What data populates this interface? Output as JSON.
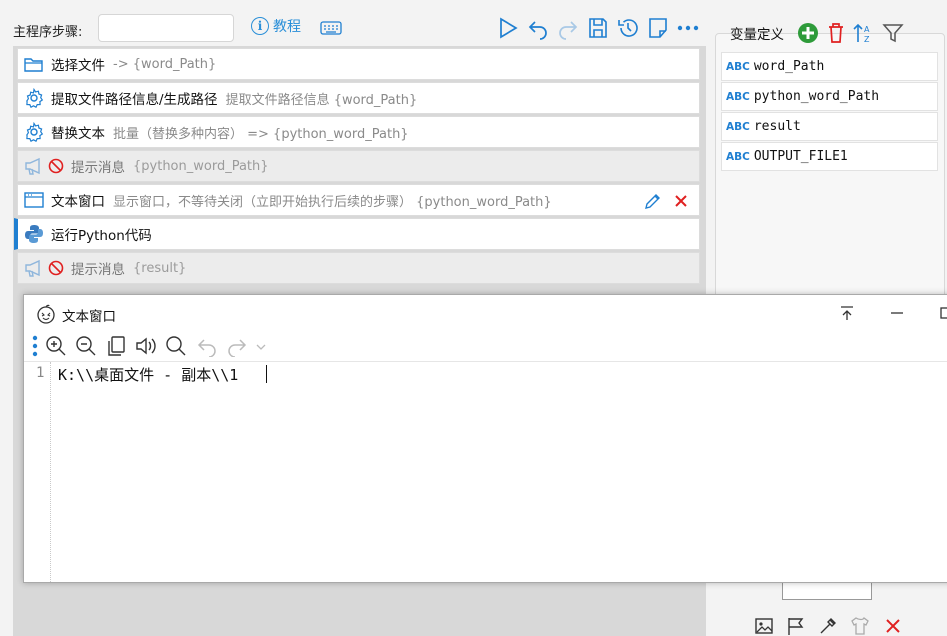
{
  "toolbar": {
    "steps_label": "主程序步骤:",
    "steps_input_value": "",
    "tutorial_label": "教程",
    "icons": [
      "info-icon",
      "keyboard-icon",
      "run-icon",
      "undo-icon",
      "redo-icon",
      "save-icon",
      "history-icon",
      "note-icon",
      "more-icon"
    ]
  },
  "steps": [
    {
      "name": "选择文件",
      "desc": "-> {word_Path}",
      "icon": "folder-icon",
      "disabled": false
    },
    {
      "name": "提取文件路径信息/生成路径",
      "desc": "提取文件路径信息 {word_Path}",
      "icon": "gear-icon",
      "disabled": false
    },
    {
      "name": "替换文本",
      "desc": "批量（替换多种内容） => {python_word_Path}",
      "icon": "gear-icon",
      "disabled": false
    },
    {
      "name": "提示消息",
      "desc": "{python_word_Path}",
      "icon": "megaphone-icon",
      "disabled": true
    },
    {
      "name": "文本窗口",
      "desc": "显示窗口，不等待关闭（立即开始执行后续的步骤） {python_word_Path}",
      "icon": "window-icon",
      "disabled": false
    },
    {
      "name": "运行Python代码",
      "desc": "",
      "icon": "python-icon",
      "disabled": false,
      "active": true
    },
    {
      "name": "提示消息",
      "desc": "{result}",
      "icon": "megaphone-icon",
      "disabled": true
    }
  ],
  "variables": {
    "title": "变量定义",
    "type_badge": "ABC",
    "items": [
      "word_Path",
      "python_word_Path",
      "result",
      "OUTPUT_FILE1"
    ]
  },
  "text_window": {
    "title": "文本窗口",
    "line_number": "1",
    "content": "K:\\\\桌面文件 - 副本\\\\1"
  },
  "colors": {
    "accent": "#1f7fd1",
    "add_green": "#2e9b3a",
    "delete_red": "#e02020"
  }
}
